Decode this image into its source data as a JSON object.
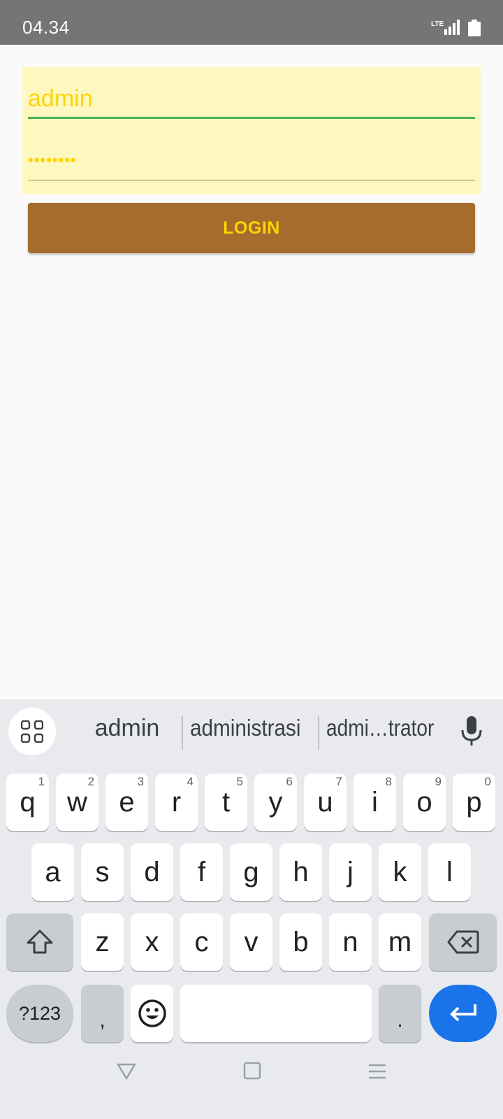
{
  "status_bar": {
    "time": "04.34",
    "network": "LTE"
  },
  "form": {
    "username_value": "admin",
    "password_value": "••••••••",
    "login_label": "LOGIN",
    "colors": {
      "panel_bg": "#fdf7c0",
      "text": "#ffd500",
      "button_bg": "#a56c2e",
      "focus_underline": "#4caf50"
    }
  },
  "keyboard": {
    "suggestions": [
      "admin",
      "administrasi",
      "admi…trator"
    ],
    "row1": [
      {
        "key": "q",
        "num": "1"
      },
      {
        "key": "w",
        "num": "2"
      },
      {
        "key": "e",
        "num": "3"
      },
      {
        "key": "r",
        "num": "4"
      },
      {
        "key": "t",
        "num": "5"
      },
      {
        "key": "y",
        "num": "6"
      },
      {
        "key": "u",
        "num": "7"
      },
      {
        "key": "i",
        "num": "8"
      },
      {
        "key": "o",
        "num": "9"
      },
      {
        "key": "p",
        "num": "0"
      }
    ],
    "row2": [
      "a",
      "s",
      "d",
      "f",
      "g",
      "h",
      "j",
      "k",
      "l"
    ],
    "row3": [
      "z",
      "x",
      "c",
      "v",
      "b",
      "n",
      "m"
    ],
    "sym_label": "?123",
    "comma": ",",
    "period": ".",
    "accent": "#1a73e8"
  }
}
